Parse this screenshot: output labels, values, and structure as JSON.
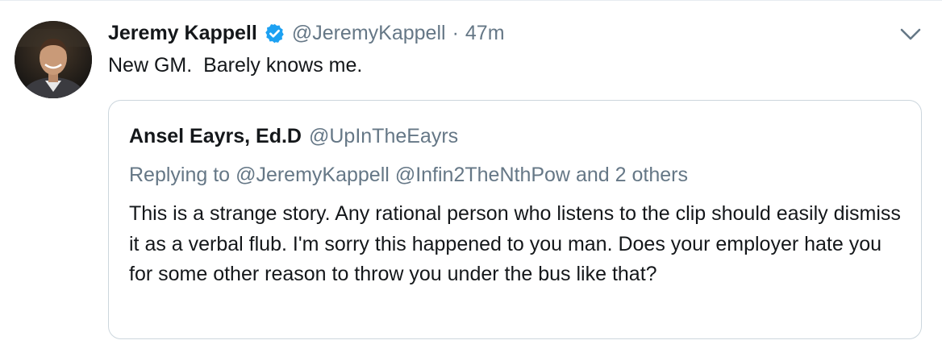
{
  "tweet": {
    "author": {
      "name": "Jeremy Kappell",
      "handle": "@JeremyKappell",
      "verified": true,
      "avatar": "profile-photo"
    },
    "separator": "·",
    "timestamp": "47m",
    "text": "New GM.  Barely knows me.",
    "menu_icon": "chevron-down-icon"
  },
  "quoted_tweet": {
    "author": {
      "name": "Ansel Eayrs, Ed.D",
      "handle": "@UpInTheEayrs"
    },
    "replying": {
      "prefix": "Replying to",
      "handle_1": "@JeremyKappell",
      "handle_2": "@Infin2TheNthPow",
      "suffix": "and 2 others"
    },
    "text": "This is a strange story.  Any rational person who listens to the clip should easily dismiss it as a verbal flub.  I'm sorry this happened to you man.  Does your employer hate you for some other reason to throw you under the bus like that?"
  },
  "colors": {
    "primary_text": "#14171a",
    "secondary_text": "#657786",
    "verified_blue": "#1da1f2",
    "border": "#ccd6dd"
  }
}
